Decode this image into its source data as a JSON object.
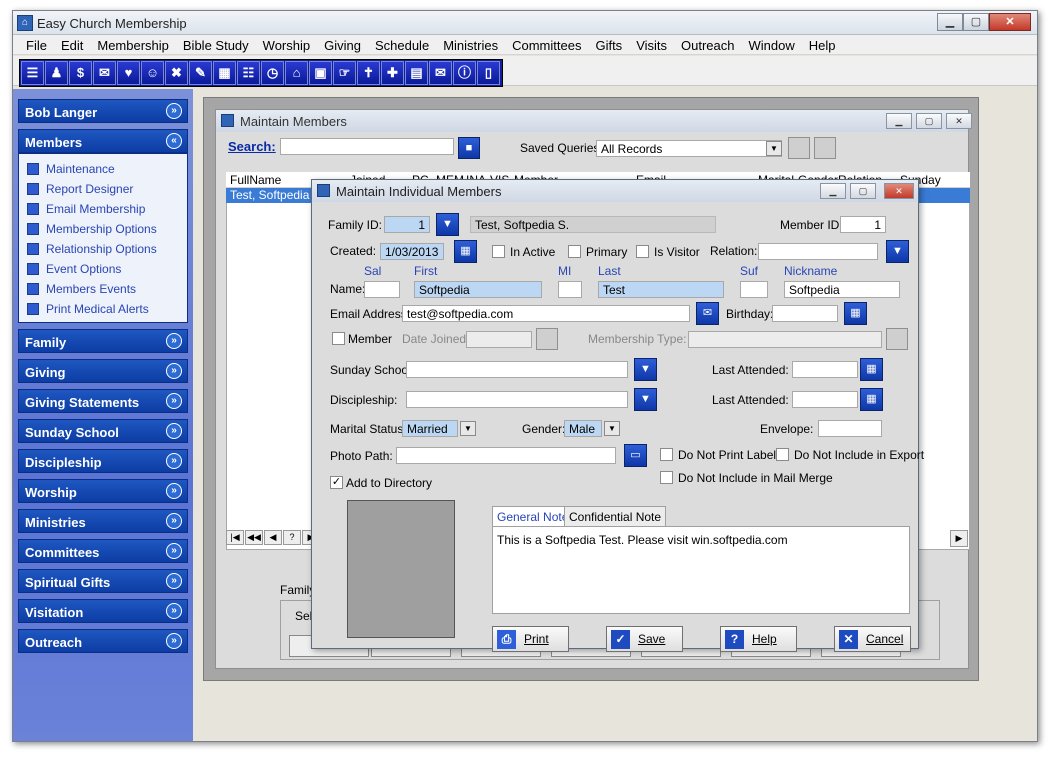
{
  "app": {
    "title": "Easy Church Membership"
  },
  "menu": [
    "File",
    "Edit",
    "Membership",
    "Bible Study",
    "Worship",
    "Giving",
    "Schedule",
    "Ministries",
    "Committees",
    "Gifts",
    "Visits",
    "Outreach",
    "Window",
    "Help"
  ],
  "toolbar_icons": [
    "members-icon",
    "person-icon",
    "dollar-icon",
    "mail-icon",
    "heart-icon",
    "group-icon",
    "tools-icon",
    "pen-icon",
    "calendar-icon",
    "people-icon",
    "clock-icon",
    "home-icon",
    "page-icon",
    "hand-icon",
    "church-icon",
    "wrench-icon",
    "book-icon",
    "envelope-icon",
    "info-icon",
    "door-icon"
  ],
  "sidebar": {
    "user": "Bob Langer",
    "members_header": "Members",
    "items": [
      "Maintenance",
      "Report Designer",
      "Email Membership",
      "Membership Options",
      "Relationship Options",
      "Event Options",
      "Members Events",
      "Print Medical Alerts"
    ],
    "sections": [
      "Family",
      "Giving",
      "Giving Statements",
      "Sunday School",
      "Discipleship",
      "Worship",
      "Ministries",
      "Committees",
      "Spiritual Gifts",
      "Visitation",
      "Outreach"
    ]
  },
  "maintain_members": {
    "title": "Maintain Members",
    "search_label": "Search:",
    "saved_queries_label": "Saved Queries:",
    "saved_queries_value": "All Records",
    "columns": [
      "FullName",
      "Joined",
      "PC",
      "MEM",
      "INA",
      "VIS",
      "Member",
      "Email",
      "Marital",
      "Gender",
      "Relation",
      "Sunday School"
    ],
    "row": "Test, Softpedia",
    "family_label": "Family",
    "sel_label": "Sel"
  },
  "dialog": {
    "title": "Maintain Individual Members",
    "family_id_label": "Family ID:",
    "family_id": "1",
    "family_name": "Test, Softpedia S.",
    "member_id_label": "Member ID:",
    "member_id": "1",
    "created_label": "Created:",
    "created": "1/03/2013",
    "in_active": "In Active",
    "primary": "Primary",
    "is_visitor": "Is Visitor",
    "relation_label": "Relation:",
    "name_label": "Name:",
    "col_sal": "Sal",
    "col_first": "First",
    "col_mi": "MI",
    "col_last": "Last",
    "col_suf": "Suf",
    "col_nick": "Nickname",
    "first": "Softpedia",
    "last": "Test",
    "nickname": "Softpedia",
    "email_label": "Email Address:",
    "email": "test@softpedia.com",
    "birthday_label": "Birthday:",
    "member_label": "Member",
    "date_joined_label": "Date Joined:",
    "membership_type_label": "Membership Type:",
    "sunday_school_label": "Sunday School:",
    "last_attended_label": "Last Attended:",
    "discipleship_label": "Discipleship:",
    "marital_label": "Marital Status:",
    "marital": "Married",
    "gender_label": "Gender:",
    "gender": "Male",
    "envelope_label": "Envelope:",
    "photo_label": "Photo Path:",
    "no_print": "Do Not Print Label",
    "no_export": "Do Not Include in Export",
    "no_merge": "Do Not Include in Mail Merge",
    "add_dir": "Add to Directory",
    "tab_general": "General Note",
    "tab_conf": "Confidential Note",
    "note": "This is a Softpedia Test. Please visit win.softpedia.com",
    "print": "Print",
    "save": "Save",
    "help": "Help",
    "cancel": "Cancel"
  }
}
